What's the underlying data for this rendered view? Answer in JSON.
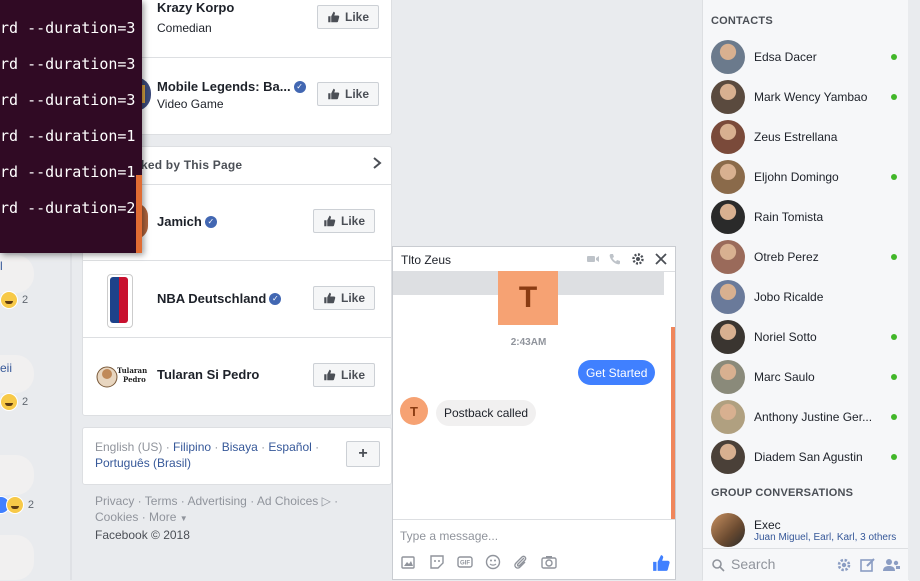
{
  "terminal": {
    "lines": [
      "rd --duration=3",
      "rd --duration=3",
      "rd --duration=3",
      "rd --duration=1",
      "rd --duration=1",
      "rd --duration=2"
    ]
  },
  "left_fragments": {
    "msg1": "l",
    "msg2": "eii",
    "reaction_counts": [
      "2",
      "2",
      "2"
    ]
  },
  "pages_top": [
    {
      "name": "Krazy Korpo",
      "sub": "Comedian",
      "like": "Like",
      "verified": false
    },
    {
      "name": "Mobile Legends: Ba...",
      "sub": "Video Game",
      "like": "Like",
      "verified": true
    }
  ],
  "liked_section": {
    "title": "ked by This Page",
    "items": [
      {
        "name": "Jamich",
        "like": "Like",
        "verified": true
      },
      {
        "name": "NBA Deutschland",
        "like": "Like",
        "verified": true
      },
      {
        "name": "Tularan Si Pedro",
        "like": "Like",
        "verified": false
      }
    ],
    "tularan_logo_text": "Tularan Si Pedro"
  },
  "languages": {
    "current": "English (US)",
    "links": [
      "Filipino",
      "Bisaya",
      "Español",
      "Português (Brasil)"
    ],
    "plus": "+"
  },
  "footer": {
    "links": [
      "Privacy",
      "Terms",
      "Advertising",
      "Ad Choices",
      "Cookies",
      "More"
    ],
    "copyright": "Facebook © 2018"
  },
  "chat": {
    "title": "Tlto Zeus",
    "avatar_letter": "T",
    "time": "2:43AM",
    "sent_message": "Get Started",
    "received_message": "Postback called",
    "input_placeholder": "Type a message..."
  },
  "contacts": {
    "title": "CONTACTS",
    "items": [
      {
        "name": "Edsa Dacer",
        "online": true,
        "color": "#6b7a8c"
      },
      {
        "name": "Mark Wency Yambao",
        "online": true,
        "color": "#5a4a3e"
      },
      {
        "name": "Zeus Estrellana",
        "online": false,
        "color": "#7a4a3a"
      },
      {
        "name": "Eljohn Domingo",
        "online": true,
        "color": "#8a6a4a"
      },
      {
        "name": "Rain Tomista",
        "online": false,
        "color": "#2a2a2a"
      },
      {
        "name": "Otreb Perez",
        "online": true,
        "color": "#9a6a5a"
      },
      {
        "name": "Jobo Ricalde",
        "online": false,
        "color": "#6a7a9a"
      },
      {
        "name": "Noriel Sotto",
        "online": true,
        "color": "#3a3530"
      },
      {
        "name": "Marc Saulo",
        "online": true,
        "color": "#8a8a7a"
      },
      {
        "name": "Anthony Justine Ger...",
        "online": true,
        "color": "#b0a080"
      },
      {
        "name": "Diadem San Agustin",
        "online": true,
        "color": "#4a4038"
      }
    ]
  },
  "group_conversations": {
    "title": "GROUP CONVERSATIONS",
    "items": [
      {
        "name": "Exec",
        "members": "Juan Miguel, Earl, Karl, 3 others"
      }
    ]
  },
  "search": {
    "placeholder": "Search"
  }
}
